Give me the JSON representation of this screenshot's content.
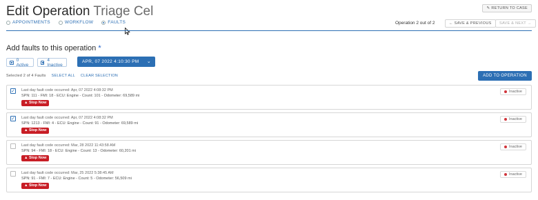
{
  "header": {
    "title": "Edit Operation",
    "subtitle": "Triage Cel",
    "return_button": "RETURN TO CASE"
  },
  "tabs": [
    {
      "label": "APPOINTMENTS",
      "selected": false
    },
    {
      "label": "WORKFLOW",
      "selected": false
    },
    {
      "label": "FAULTS",
      "selected": true
    }
  ],
  "operation_nav": {
    "count_text": "Operation 2 out of 2",
    "prev_label": "SAVE & PREVIOUS",
    "next_label": "SAVE & NEXT"
  },
  "faults_section": {
    "heading": "Add faults to this operation",
    "required_mark": "*",
    "active_filter": "0 Active",
    "inactive_filter": "4 Inactive",
    "date_filter": "APR, 07 2022 4:10:30 PM",
    "selected_text": "Selected 2 of 4 Faults",
    "select_all": "SELECT ALL",
    "clear_selection": "CLEAR SELECTION",
    "add_button": "ADD TO OPERATION"
  },
  "faults": [
    {
      "checked": true,
      "occurred": "Last day fault code occurred: Apr, 07 2022 4:08:32 PM",
      "details": "SPN: 111 - FMI: 18 - ECU: Engine - Count: 101 - Odometer: 69,589 mi",
      "severity": "Stop Now",
      "status": "Inactive"
    },
    {
      "checked": true,
      "occurred": "Last day fault code occurred: Apr, 07 2022 4:08:32 PM",
      "details": "SPN: 1213 - FMI: 4 - ECU: Engine - Count: 91 - Odometer: 69,589 mi",
      "severity": "Stop Now",
      "status": "Inactive"
    },
    {
      "checked": false,
      "occurred": "Last day fault code occurred: Mar, 28 2022 11:43:58 AM",
      "details": "SPN: 94 - FMI: 18 - ECU: Engine - Count: 13 - Odometer: 60,201 mi",
      "severity": "Stop Now",
      "status": "Inactive"
    },
    {
      "checked": false,
      "occurred": "Last day fault code occurred: Mar, 25 2022 5:38:45 AM",
      "details": "SPN: 91 - FMI: 7 - ECU: Engine - Count: 5 - Odometer: 56,509 mi",
      "severity": "Stop Now",
      "status": "Inactive"
    }
  ],
  "colors": {
    "accent": "#2c6fb4",
    "stop_badge": "#c81d25",
    "status_dot": "#d0343b"
  }
}
